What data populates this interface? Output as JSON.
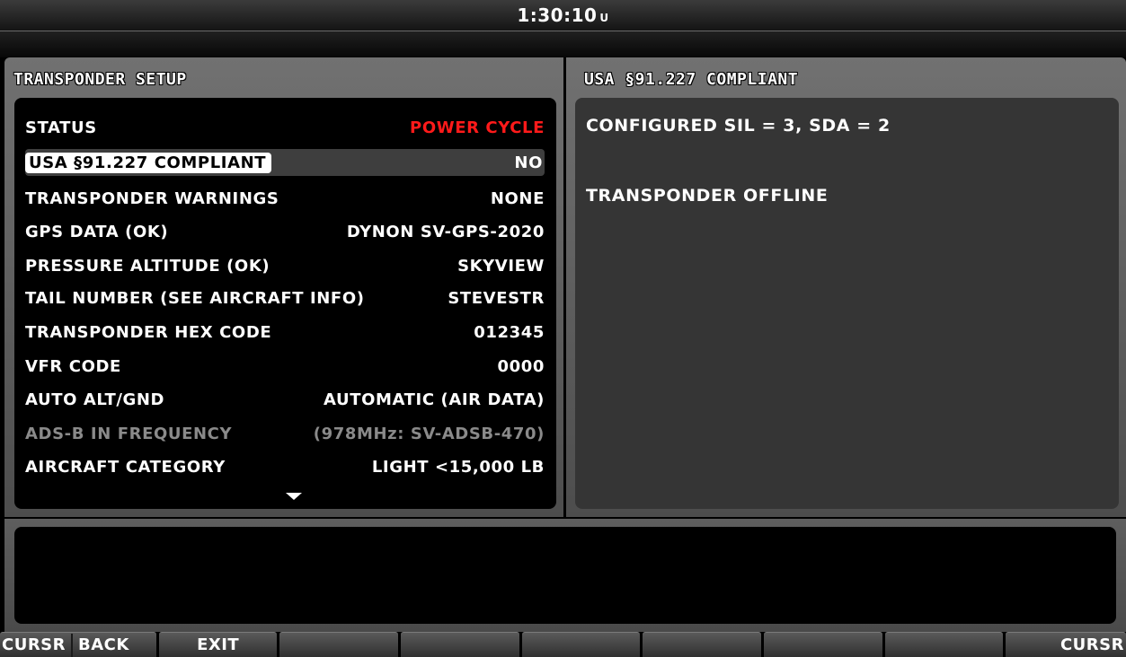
{
  "header": {
    "time": "1:30:10",
    "time_suffix": "U"
  },
  "left_panel": {
    "title": "TRANSPONDER SETUP",
    "rows": [
      {
        "label": "STATUS",
        "value": "POWER CYCLE"
      },
      {
        "label": "USA §91.227 COMPLIANT",
        "value": "NO"
      },
      {
        "label": "TRANSPONDER WARNINGS",
        "value": "NONE"
      },
      {
        "label": "GPS DATA (OK)",
        "value": "DYNON SV-GPS-2020"
      },
      {
        "label": "PRESSURE ALTITUDE (OK)",
        "value": "SKYVIEW"
      },
      {
        "label": "TAIL NUMBER (SEE AIRCRAFT INFO)",
        "value": "STEVESTR"
      },
      {
        "label": "TRANSPONDER HEX CODE",
        "value": "012345"
      },
      {
        "label": "VFR CODE",
        "value": "0000"
      },
      {
        "label": "AUTO ALT/GND",
        "value": "AUTOMATIC (AIR DATA)"
      },
      {
        "label": "ADS-B IN FREQUENCY",
        "value": "(978MHz: SV-ADSB-470)"
      },
      {
        "label": "AIRCRAFT CATEGORY",
        "value": "LIGHT <15,000 LB"
      }
    ]
  },
  "right_panel": {
    "title": "USA §91.227 COMPLIANT",
    "lines": [
      "CONFIGURED SIL = 3, SDA = 2",
      "TRANSPONDER OFFLINE"
    ]
  },
  "softkeys": {
    "left_cursr": "CURSR",
    "back": "BACK",
    "exit": "EXIT",
    "right_cursr": "CURSR"
  },
  "colors": {
    "status_warning": "#ff1a1a",
    "disabled_text": "#8a8a8a",
    "selection_bg": "#ffffff"
  },
  "icons": [
    "scroll-down-arrow-icon",
    "left-edge-marker-icon"
  ]
}
